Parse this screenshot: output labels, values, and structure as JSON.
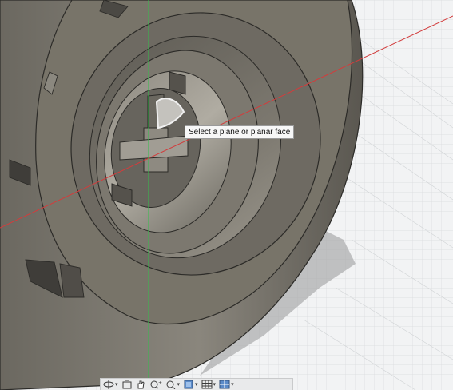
{
  "viewport": {
    "tooltip": "Select a plane or planar face",
    "colors": {
      "grid_background": "#f2f3f4",
      "grid_line": "#d8dadc",
      "body_dark": "#5f5c55",
      "body_mid": "#7e7b73",
      "body_light": "#a19d94",
      "x_axis": "#d23c3c",
      "y_axis": "#33c04a",
      "tan_body": "#c8a25a"
    }
  },
  "navigation_bar": {
    "tools": [
      {
        "name": "orbit-icon",
        "has_dropdown": true
      },
      {
        "name": "look-at-icon",
        "has_dropdown": false
      },
      {
        "name": "pan-icon",
        "has_dropdown": false
      },
      {
        "name": "zoom-icon",
        "has_dropdown": false
      },
      {
        "name": "fit-icon",
        "has_dropdown": true
      },
      {
        "name": "display-settings-icon",
        "has_dropdown": true
      },
      {
        "name": "grid-settings-icon",
        "has_dropdown": true
      },
      {
        "name": "viewports-icon",
        "has_dropdown": true
      }
    ]
  }
}
